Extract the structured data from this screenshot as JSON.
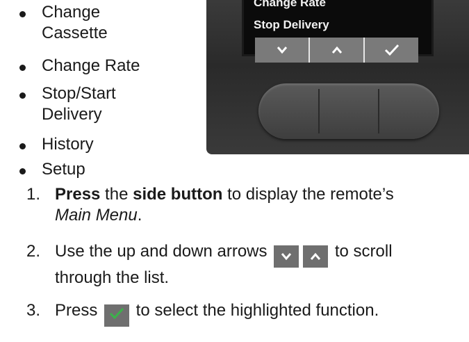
{
  "bullets": [
    {
      "line1": "Change",
      "line2": "Cassette"
    },
    {
      "line1": "Change Rate",
      "line2": ""
    },
    {
      "line1": "Stop/Start",
      "line2": "Delivery"
    },
    {
      "line1": "History",
      "line2": ""
    },
    {
      "line1": "Setup",
      "line2": ""
    }
  ],
  "device": {
    "screen_lines": [
      "Change Rate",
      "Stop Delivery"
    ],
    "softkey_icons": [
      "chevron-down-icon",
      "chevron-up-icon",
      "check-icon"
    ]
  },
  "steps": [
    {
      "num": "1.",
      "bold1": "Press",
      "t1": " the ",
      "bold2": "side button",
      "t2": " to display the remote’s ",
      "italic": "Main Menu",
      "t3": "."
    },
    {
      "num": "2.",
      "t1": "Use the up and down arrows ",
      "t2": " to scroll",
      "t3": "through the list."
    },
    {
      "num": "3.",
      "t1": "Press ",
      "t2": " to select the highlighted function."
    }
  ]
}
